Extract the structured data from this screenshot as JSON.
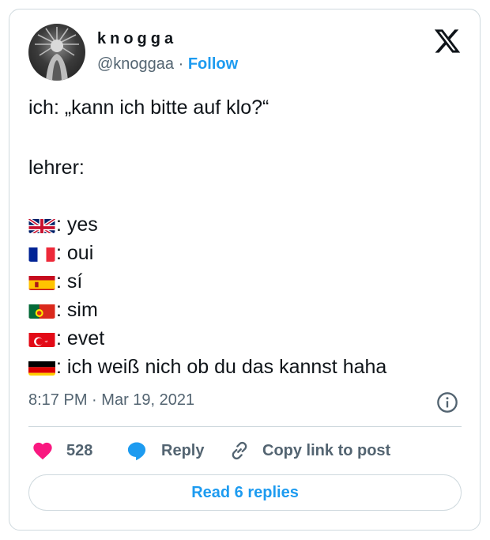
{
  "author": {
    "display_name": "knogga",
    "handle": "@knoggaa",
    "separator": "·",
    "follow_label": "Follow"
  },
  "tweet": {
    "line_ask": "ich: „kann ich bitte auf klo?“",
    "line_teacher": "lehrer:",
    "answers": [
      {
        "flag": "uk-flag",
        "text": ": yes"
      },
      {
        "flag": "france-flag",
        "text": ": oui"
      },
      {
        "flag": "spain-flag",
        "text": ": sí"
      },
      {
        "flag": "portugal-flag",
        "text": ": sim"
      },
      {
        "flag": "turkey-flag",
        "text": ": evet"
      },
      {
        "flag": "germany-flag",
        "text": ": ich weiß nich ob du das kannst haha"
      }
    ]
  },
  "meta": {
    "time": "8:17 PM",
    "separator": "·",
    "date": "Mar 19, 2021"
  },
  "actions": {
    "like_count": "528",
    "reply_label": "Reply",
    "copy_label": "Copy link to post"
  },
  "read_replies_label": "Read 6 replies",
  "colors": {
    "accent": "#1d9bf0",
    "like": "#f91880",
    "secondary_text": "#536471",
    "border": "#cfd9de"
  }
}
